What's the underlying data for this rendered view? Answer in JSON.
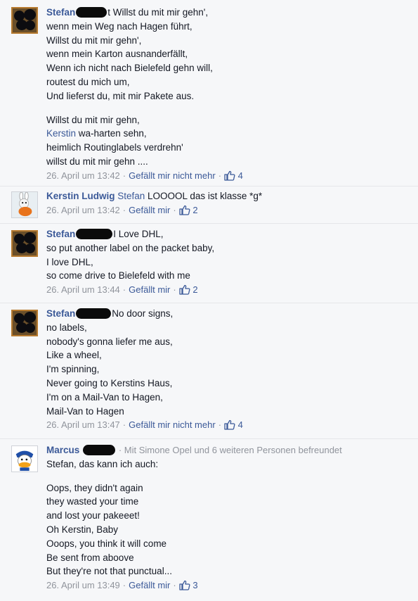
{
  "comments": [
    {
      "author": "Stefan",
      "lines": [
        "t Willst du mit mir gehn',",
        "wenn mein Weg nach Hagen führt,",
        "Willst du mit mir gehn',",
        "wenn mein Karton ausnanderfällt,",
        "Wenn ich nicht nach Bielefeld gehn will,",
        "routest du mich um,",
        "Und lieferst du, mit mir Pakete aus."
      ],
      "stanza2_line1": "Willst du mit mir gehn,",
      "mention": "Kerstin",
      "mention_rest": " wa-harten sehn,",
      "stanza2_rest": [
        "heimlich Routinglabels verdrehn'",
        "willst du mit mir gehn ...."
      ],
      "time": "26. April um 13:42",
      "like_label": "Gefällt mir nicht mehr",
      "like_count": "4"
    },
    {
      "author": "Kerstin Ludwig",
      "mention": "Stefan",
      "text": " LOOOOL das ist klasse *g*",
      "time": "26. April um 13:42",
      "like_label": "Gefällt mir",
      "like_count": "2"
    },
    {
      "author": "Stefan",
      "lines": [
        "I Love DHL,",
        "so put another label on the packet baby,",
        "I love DHL,",
        "so come drive to Bielefeld with me"
      ],
      "time": "26. April um 13:44",
      "like_label": "Gefällt mir",
      "like_count": "2"
    },
    {
      "author": "Stefan",
      "lines": [
        "No door signs,",
        "no labels,",
        "nobody's gonna liefer me aus,",
        "Like a wheel,",
        "I'm spinning,",
        "Never going to Kerstins Haus,",
        "I'm on a Mail-Van to Hagen,",
        "Mail-Van to Hagen"
      ],
      "time": "26. April um 13:47",
      "like_label": "Gefällt mir nicht mehr",
      "like_count": "4"
    },
    {
      "author": "Marcus",
      "friend_info": "· Mit Simone Opel und 6 weiteren Personen befreundet",
      "intro": "Stefan, das kann ich auch:",
      "lines": [
        "Oops, they didn't again",
        "they wasted your time",
        "and lost your pakeeet!",
        "Oh Kerstin, Baby",
        "Ooops, you think it will come",
        "Be sent from aboove",
        "But they're not that punctual..."
      ],
      "time": "26. April um 13:49",
      "like_label": "Gefällt mir",
      "like_count": "3"
    }
  ],
  "icons": {
    "like": "thumbs-up-icon"
  },
  "colors": {
    "link": "#3b5998",
    "meta": "#90949c",
    "background": "#f6f7f9"
  }
}
